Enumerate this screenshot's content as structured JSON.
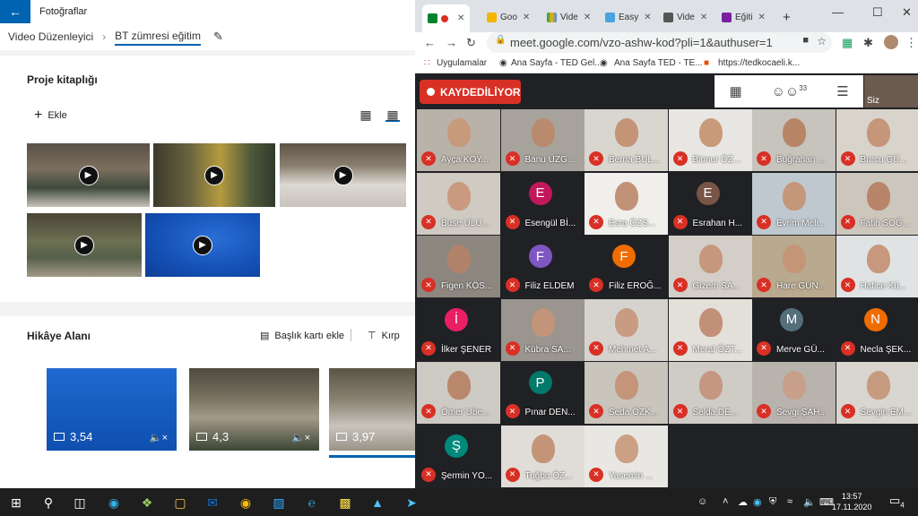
{
  "photos": {
    "app_title": "Fotoğraflar",
    "breadcrumb": [
      "Video Düzenleyici",
      "BT zümresi eğitim"
    ],
    "library_title": "Proje kitaplığı",
    "add_label": "Ekle",
    "story_title": "Hikâye Alanı",
    "add_title_card": "Başlık kartı ekle",
    "crop_label": "Kırp",
    "story_cards": [
      {
        "duration": "3,54"
      },
      {
        "duration": "4,3"
      },
      {
        "duration": "3,97"
      }
    ]
  },
  "browser": {
    "tabs": [
      "",
      "Goo",
      "Vide",
      "Easy",
      "Vide",
      "Eğiti"
    ],
    "url": "meet.google.com/vzo-ashw-kod?pli=1&authuser=1",
    "bookmarks": [
      "Uygulamalar",
      "Ana Sayfa - TED Gel...",
      "Ana Sayfa TED - TE...",
      "https://tedkocaeli.k..."
    ]
  },
  "meet": {
    "recording_label": "KAYDEDİLİYOR",
    "people_count": "33",
    "self_label": "Siz",
    "participants": [
      {
        "name": "Ayça KÖY...",
        "type": "face",
        "bg": "#b9b2a8",
        "skin": "#c89a7c"
      },
      {
        "name": "Banu ÜZG...",
        "type": "face",
        "bg": "#a7a39c",
        "skin": "#b98a6e"
      },
      {
        "name": "Berna BUL...",
        "type": "face",
        "bg": "#d9d6d0",
        "skin": "#c49477"
      },
      {
        "name": "Binnur ÖZ...",
        "type": "face",
        "bg": "#e8e6e2",
        "skin": "#c99a7a"
      },
      {
        "name": "Buğrahan ...",
        "type": "face",
        "bg": "#c7c3bd",
        "skin": "#b88566"
      },
      {
        "name": "Burcu GÜ...",
        "type": "face",
        "bg": "#d8d4cc",
        "skin": "#c6967a"
      },
      {
        "name": "Buse ULU...",
        "type": "face",
        "bg": "#cfcac2",
        "skin": "#c99a80"
      },
      {
        "name": "Esengül Bİ...",
        "type": "avatar",
        "initial": "E",
        "color": "#c2185b"
      },
      {
        "name": "Esra ÖZS...",
        "type": "face",
        "bg": "#f0efec",
        "skin": "#c19278"
      },
      {
        "name": "Esrahan H...",
        "type": "avatar",
        "initial": "E",
        "color": "#795548"
      },
      {
        "name": "Evrim Meli...",
        "type": "face",
        "bg": "#bfc8cf",
        "skin": "#c4967a"
      },
      {
        "name": "Fatih SOĞ...",
        "type": "face",
        "bg": "#ccc6bd",
        "skin": "#b8856a"
      },
      {
        "name": "Figen KÖS...",
        "type": "face",
        "bg": "#8d8780",
        "skin": "#b0826a"
      },
      {
        "name": "Filiz ELDEM",
        "type": "avatar",
        "initial": "F",
        "color": "#7e57c2"
      },
      {
        "name": "Filiz EROĞ...",
        "type": "avatar",
        "initial": "F",
        "color": "#ef6c00"
      },
      {
        "name": "Gizem SA...",
        "type": "face",
        "bg": "#d3cfc8",
        "skin": "#c6977c"
      },
      {
        "name": "Hare GÜN...",
        "type": "face",
        "bg": "#b9a98e",
        "skin": "#c59578"
      },
      {
        "name": "Hatice Kü...",
        "type": "face",
        "bg": "#dfe3e4",
        "skin": "#c7987e"
      },
      {
        "name": "İlker ŞENER",
        "type": "avatar",
        "initial": "İ",
        "color": "#e91e63"
      },
      {
        "name": "Kübra SA...",
        "type": "face",
        "bg": "#9a958f",
        "skin": "#c39479"
      },
      {
        "name": "Mehmet A...",
        "type": "face",
        "bg": "#d6d3ce",
        "skin": "#c89c82"
      },
      {
        "name": "Meral ÖZT...",
        "type": "face",
        "bg": "#e3dfd9",
        "skin": "#c29077"
      },
      {
        "name": "Merve GÜ...",
        "type": "avatar",
        "initial": "M",
        "color": "#546e7a"
      },
      {
        "name": "Necla ŞEK...",
        "type": "avatar",
        "initial": "N",
        "color": "#ef6c00"
      },
      {
        "name": "Ömer Ube...",
        "type": "face",
        "bg": "#cdc9c3",
        "skin": "#b9876b"
      },
      {
        "name": "Pınar DEN...",
        "type": "avatar",
        "initial": "P",
        "color": "#00796b"
      },
      {
        "name": "Seda ÖZK...",
        "type": "face",
        "bg": "#c9c4bc",
        "skin": "#c49579"
      },
      {
        "name": "Selda DE...",
        "type": "face",
        "bg": "#cfcbc5",
        "skin": "#c59780"
      },
      {
        "name": "Sevgi ŞAH...",
        "type": "face",
        "bg": "#b8b3ac",
        "skin": "#c8a08a"
      },
      {
        "name": "Sevgin EM...",
        "type": "face",
        "bg": "#d9d5cf",
        "skin": "#c79b80"
      },
      {
        "name": "Şermin YO...",
        "type": "avatar",
        "initial": "Ş",
        "color": "#00897b"
      },
      {
        "name": "Tuğba ÖZ...",
        "type": "face",
        "bg": "#e0ddd8",
        "skin": "#c49479"
      },
      {
        "name": "Yasemin ...",
        "type": "face",
        "bg": "#e9e7e3",
        "skin": "#cba085"
      }
    ]
  },
  "taskbar": {
    "time": "13:57",
    "date": "17.11.2020",
    "notifications": "4"
  }
}
